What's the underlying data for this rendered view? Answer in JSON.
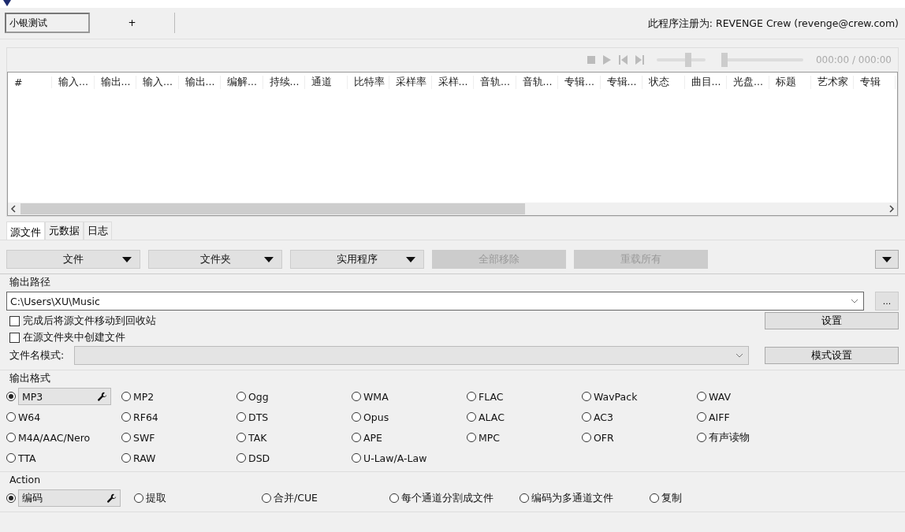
{
  "profile_tabs": [
    {
      "label": "小银测试",
      "selected": true
    },
    {
      "label": "+",
      "selected": false
    }
  ],
  "registration": "此程序注册为: REVENGE Crew (revenge@crew.com)",
  "player": {
    "volume": {
      "level": 0.65
    },
    "seek": {
      "level": 0
    },
    "time": "000:00 / 000:00"
  },
  "table": {
    "columns": [
      "#",
      "输入...",
      "输出...",
      "输入...",
      "输出...",
      "编解...",
      "持续...",
      "通道",
      "比特率",
      "采样率",
      "采样...",
      "音轨...",
      "音轨...",
      "专辑...",
      "专辑...",
      "状态",
      "曲目...",
      "光盘...",
      "标题",
      "艺术家",
      "专辑"
    ]
  },
  "bottom_tabs": [
    {
      "label": "源文件",
      "selected": true
    },
    {
      "label": "元数据",
      "selected": false
    },
    {
      "label": "日志",
      "selected": false
    }
  ],
  "toolbar": [
    {
      "label": "文件",
      "disabled": false,
      "dropdown": true
    },
    {
      "label": "文件夹",
      "disabled": false,
      "dropdown": true
    },
    {
      "label": "实用程序",
      "disabled": false,
      "dropdown": true
    },
    {
      "label": "全部移除",
      "disabled": true,
      "dropdown": false
    },
    {
      "label": "重载所有",
      "disabled": true,
      "dropdown": false
    }
  ],
  "output_path": {
    "title": "输出路径",
    "value": "C:\\Users\\XU\\Music",
    "browse": "...",
    "settings_button": "设置",
    "options": [
      {
        "label": "完成后将源文件移动到回收站",
        "checked": false
      },
      {
        "label": "在源文件夹中创建文件",
        "checked": false
      }
    ],
    "filename_label": "文件名模式:",
    "pattern_button": "模式设置"
  },
  "output_format": {
    "title": "输出格式",
    "rows": [
      [
        {
          "label": "MP3",
          "selected": true
        },
        {
          "label": "MP2",
          "selected": false
        },
        {
          "label": "Ogg",
          "selected": false
        },
        {
          "label": "WMA",
          "selected": false
        },
        {
          "label": "FLAC",
          "selected": false
        },
        {
          "label": "WavPack",
          "selected": false
        },
        {
          "label": "WAV",
          "selected": false
        }
      ],
      [
        {
          "label": "W64",
          "selected": false
        },
        {
          "label": "RF64",
          "selected": false
        },
        {
          "label": "DTS",
          "selected": false
        },
        {
          "label": "Opus",
          "selected": false
        },
        {
          "label": "ALAC",
          "selected": false
        },
        {
          "label": "AC3",
          "selected": false
        },
        {
          "label": "AIFF",
          "selected": false
        }
      ],
      [
        {
          "label": "M4A/AAC/Nero",
          "selected": false
        },
        {
          "label": "SWF",
          "selected": false
        },
        {
          "label": "TAK",
          "selected": false
        },
        {
          "label": "APE",
          "selected": false
        },
        {
          "label": "MPC",
          "selected": false
        },
        {
          "label": "OFR",
          "selected": false
        },
        {
          "label": "有声读物",
          "selected": false
        }
      ],
      [
        {
          "label": "TTA",
          "selected": false
        },
        {
          "label": "RAW",
          "selected": false
        },
        {
          "label": "DSD",
          "selected": false
        },
        {
          "label": "U-Law/A-Law",
          "selected": false
        }
      ]
    ]
  },
  "action": {
    "title": "Action",
    "items": [
      {
        "label": "编码",
        "selected": true
      },
      {
        "label": "提取",
        "selected": false
      },
      {
        "label": "合并/CUE",
        "selected": false
      },
      {
        "label": "每个通道分割成文件",
        "selected": false
      },
      {
        "label": "编码为多通道文件",
        "selected": false
      },
      {
        "label": "复制",
        "selected": false
      }
    ]
  }
}
